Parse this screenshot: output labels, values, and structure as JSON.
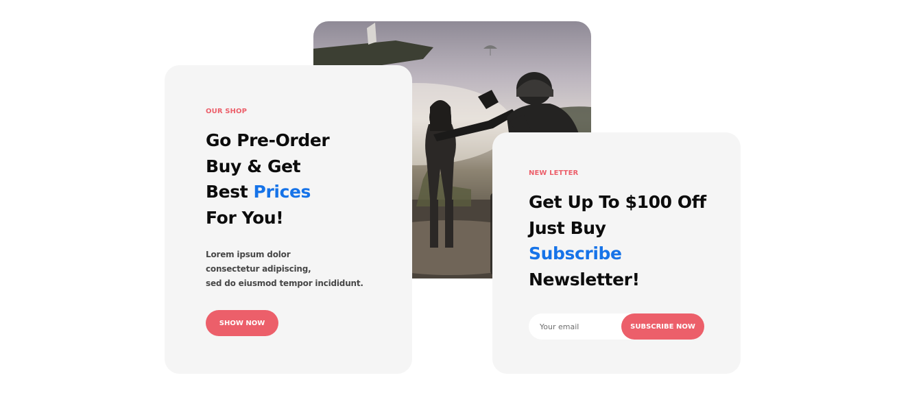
{
  "hero": {
    "image_alt": "",
    "icon": "game-artwork"
  },
  "shop_card": {
    "eyebrow": "OUR SHOP",
    "heading": {
      "line1": "Go Pre-Order",
      "line2": "Buy & Get",
      "line3_plain": "Best ",
      "line3_accent": "Prices",
      "line4": "For You!"
    },
    "body": {
      "line1": "Lorem ipsum dolor",
      "line2": "consectetur adipiscing,",
      "line3": "sed do eiusmod tempor incididunt."
    },
    "button_label": "SHOW NOW"
  },
  "newsletter_card": {
    "eyebrow": "NEW LETTER",
    "heading": {
      "line1": "Get Up To $100 Off",
      "line2": "Just Buy",
      "line3_accent": "Subscribe",
      "line4": "Newsletter!"
    },
    "email_placeholder": "Your email",
    "email_value": "",
    "button_label": "SUBSCRIBE NOW"
  },
  "colors": {
    "accent_red": "#ec5f6a",
    "accent_blue": "#1673e8",
    "card_bg": "#f5f5f5",
    "heading": "#0c0c0c"
  }
}
